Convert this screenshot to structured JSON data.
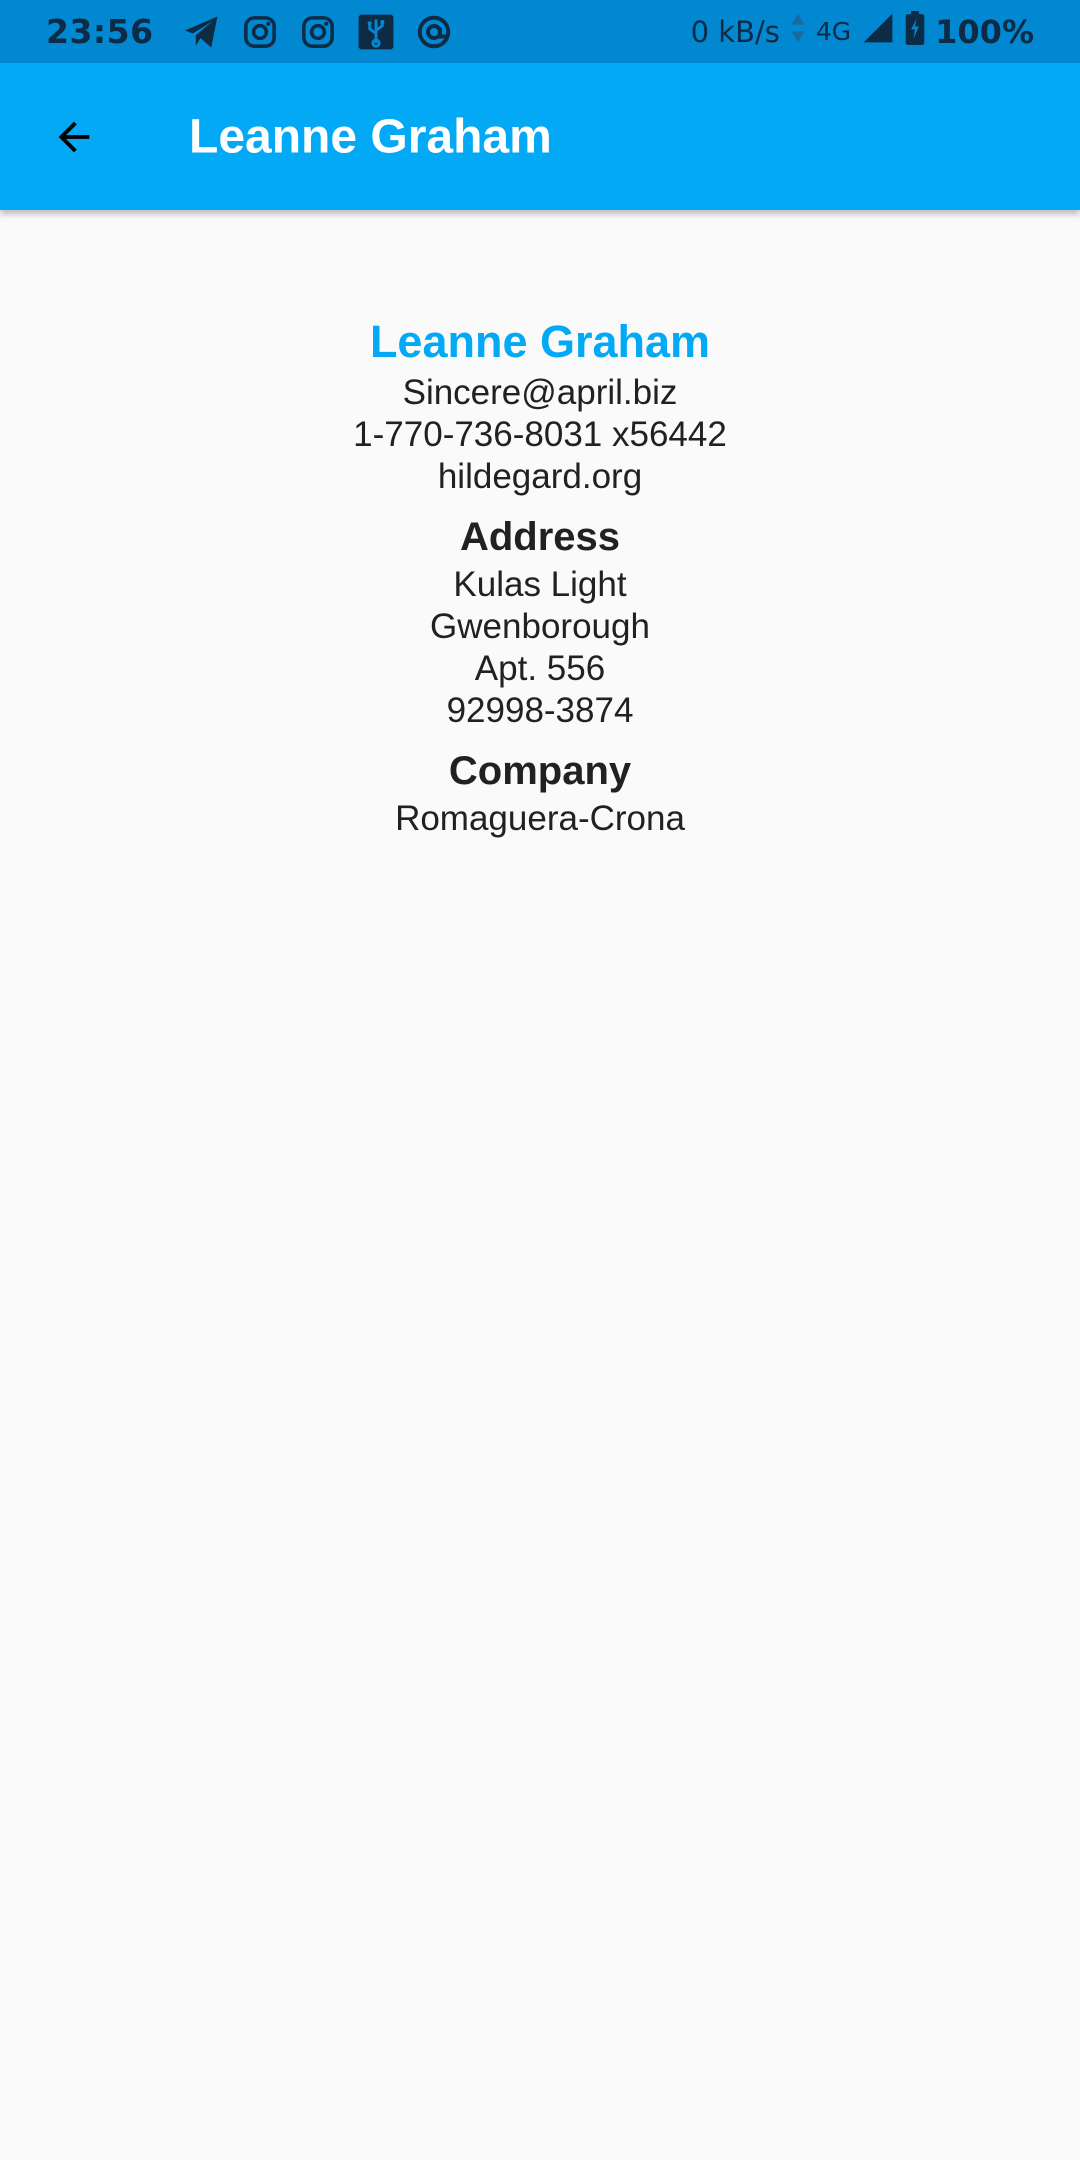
{
  "status_bar": {
    "time": "23:56",
    "left_icons": [
      "telegram-icon",
      "instagram-icon",
      "instagram-icon",
      "usb-icon",
      "at-sign-icon"
    ],
    "net_speed": "0 kB/s",
    "network": "4G",
    "battery": "100%"
  },
  "app_bar": {
    "title": "Leanne Graham",
    "background": "#03a9f4",
    "back_icon": "arrow-back-icon"
  },
  "profile": {
    "name": "Leanne Graham",
    "email": "Sincere@april.biz",
    "phone": "1-770-736-8031 x56442",
    "website": "hildegard.org",
    "address_heading": "Address",
    "address": {
      "street": "Kulas Light",
      "city": "Gwenborough",
      "suite": "Apt. 556",
      "zipcode": "92998-3874"
    },
    "company_heading": "Company",
    "company": "Romaguera-Crona"
  },
  "colors": {
    "accent": "#03a9f4",
    "status_bar": "#0288d1",
    "background": "#fafafa",
    "text": "#212121"
  }
}
